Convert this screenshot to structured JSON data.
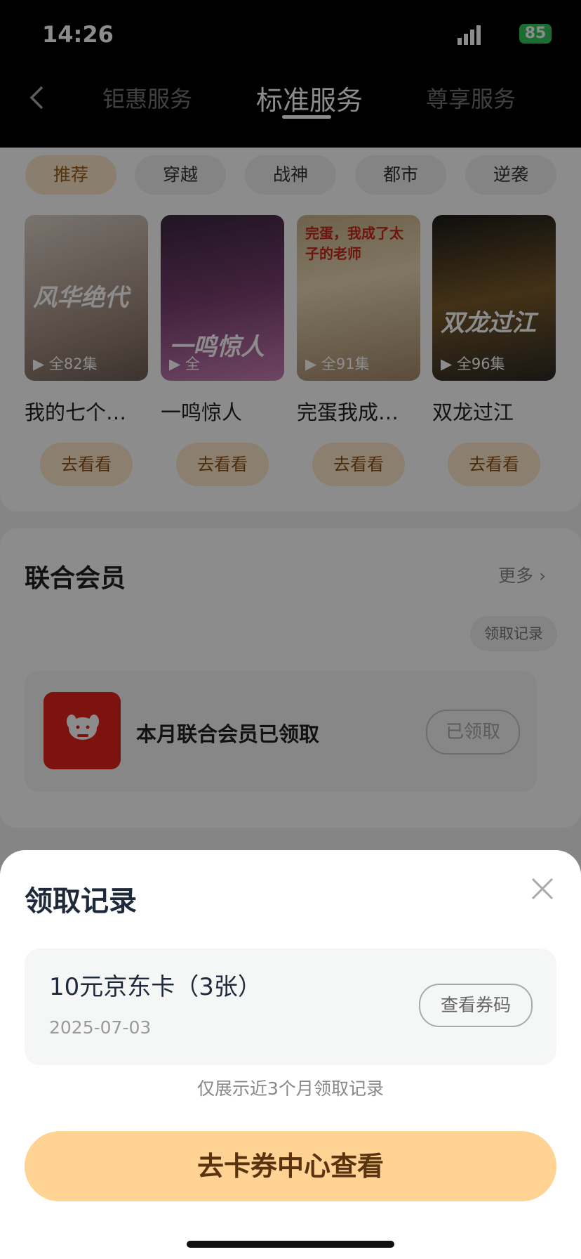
{
  "status": {
    "time": "14:26",
    "battery": "85"
  },
  "header": {
    "tabs": [
      {
        "label": "钜惠服务"
      },
      {
        "label": "标准服务"
      },
      {
        "label": "尊享服务"
      }
    ]
  },
  "categories": [
    {
      "label": "推荐"
    },
    {
      "label": "穿越"
    },
    {
      "label": "战神"
    },
    {
      "label": "都市"
    },
    {
      "label": "逆袭"
    }
  ],
  "shows": [
    {
      "title": "我的七个…",
      "episodes": "全82集",
      "art": "风华绝代",
      "button": "去看看"
    },
    {
      "title": "一鸣惊人",
      "episodes": "全",
      "art": "一鸣惊人",
      "button": "去看看"
    },
    {
      "title": "完蛋我成…",
      "episodes": "全91集",
      "art": "完蛋，我成了太子的老师",
      "button": "去看看"
    },
    {
      "title": "双龙过江",
      "episodes": "全96集",
      "art": "双龙过江",
      "button": "去看看"
    }
  ],
  "joint_member": {
    "title": "联合会员",
    "more": "更多 ›",
    "records_chip": "领取记录",
    "item_text": "本月联合会员已领取",
    "claimed_label": "已领取"
  },
  "sheet": {
    "title": "领取记录",
    "record": {
      "name": "10元京东卡（3张）",
      "date": "2025-07-03",
      "button": "查看券码"
    },
    "note": "仅展示近3个月领取记录",
    "cta": "去卡券中心查看"
  },
  "colors": {
    "accent": "#ffd394",
    "chip_active": "#fbe7c8",
    "jd_red": "#e2231a"
  }
}
